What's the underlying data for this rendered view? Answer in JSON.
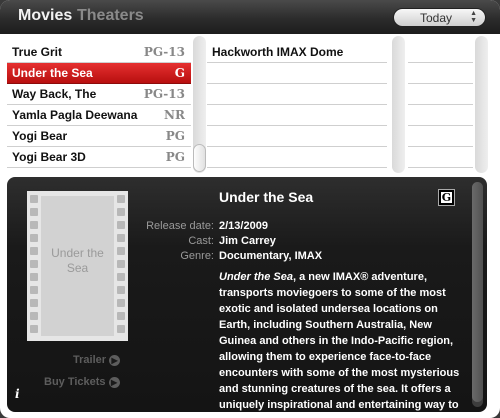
{
  "header": {
    "tab_movies": "Movies",
    "tab_theaters": "Theaters",
    "date_selected": "Today"
  },
  "movies": [
    {
      "title": "True Grit",
      "rating": "PG-13",
      "selected": false
    },
    {
      "title": "Under the Sea",
      "rating": "G",
      "selected": true
    },
    {
      "title": "Way Back, The",
      "rating": "PG-13",
      "selected": false
    },
    {
      "title": "Yamla Pagla Deewana",
      "rating": "NR",
      "selected": false
    },
    {
      "title": "Yogi Bear",
      "rating": "PG",
      "selected": false
    },
    {
      "title": "Yogi Bear 3D",
      "rating": "PG",
      "selected": false
    }
  ],
  "theaters": [
    {
      "name": "Hackworth IMAX Dome"
    }
  ],
  "detail": {
    "poster_placeholder": "Under the Sea",
    "title": "Under the Sea",
    "rating": "G",
    "release_label": "Release date:",
    "release_date": "2/13/2009",
    "cast_label": "Cast:",
    "cast": "Jim Carrey",
    "genre_label": "Genre:",
    "genre": "Documentary, IMAX",
    "synopsis_title": "Under the Sea",
    "synopsis_body": ", a new IMAX® adventure, transports moviegoers to some of the most exotic and isolated undersea locations on Earth, including Southern Australia, New Guinea and others in the Indo-Pacific region, allowing them to experience face-to-face encounters with some of the most mysterious and stunning creatures of the sea. It offers a uniquely inspirational and entertaining way to",
    "trailer_label": "Trailer",
    "buy_tickets_label": "Buy Tickets",
    "info_glyph": "i"
  },
  "icons": {
    "date_arrows": "up-down-arrows-icon",
    "action_arrow": "circle-arrow-right-icon",
    "info": "info-icon"
  }
}
